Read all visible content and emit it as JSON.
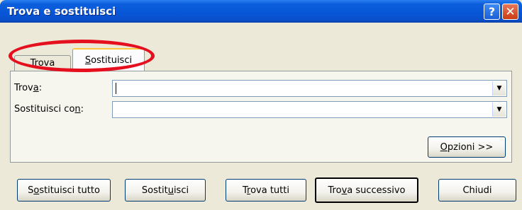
{
  "window": {
    "title": "Trova e sostituisci",
    "help_button": "?",
    "close_button": "✕"
  },
  "tabs": [
    {
      "label_pre": "",
      "label_key": "T",
      "label_post": "rova",
      "selected": false
    },
    {
      "label_pre": "",
      "label_key": "S",
      "label_post": "ostituisci",
      "selected": true
    }
  ],
  "fields": {
    "find": {
      "label_pre": "Trov",
      "label_key": "a",
      "label_post": ":",
      "value": ""
    },
    "replace": {
      "label_pre": "Sostituisci co",
      "label_key": "n",
      "label_post": ":",
      "value": ""
    }
  },
  "buttons": {
    "options": {
      "pre": "",
      "key": "O",
      "post": "pzioni >>"
    },
    "replace_all": {
      "pre": "S",
      "key": "o",
      "post": "stituisci tutto"
    },
    "replace": {
      "pre": "Sostit",
      "key": "u",
      "post": "isci"
    },
    "find_all": {
      "pre": "T",
      "key": "r",
      "post": "ova tutti"
    },
    "find_next": {
      "pre": "Tro",
      "key": "v",
      "post": "a successivo"
    },
    "close": {
      "pre": "Chiudi",
      "key": "",
      "post": ""
    }
  },
  "colors": {
    "titlebar": "#0755d6",
    "highlight": "#e50f1e",
    "active_tab_accent": "#ffc83c"
  }
}
